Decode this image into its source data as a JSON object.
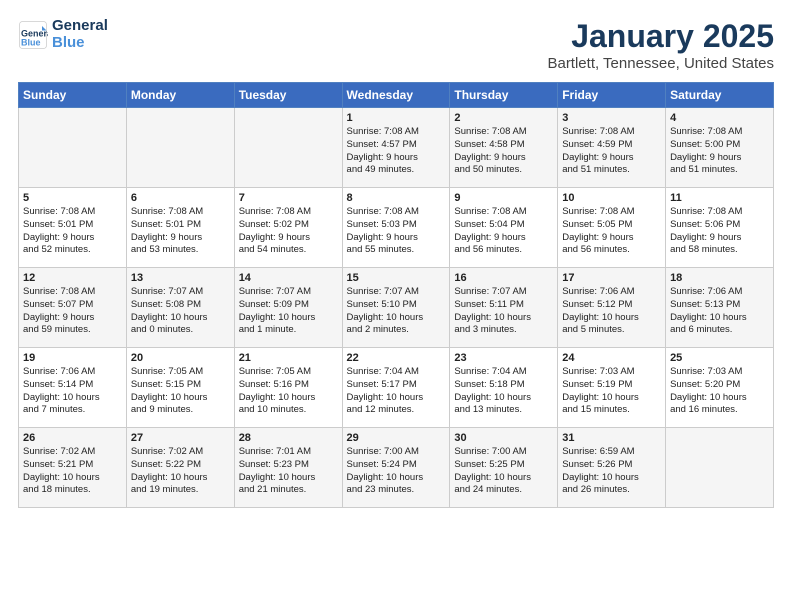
{
  "header": {
    "logo_line1": "General",
    "logo_line2": "Blue",
    "title": "January 2025",
    "subtitle": "Bartlett, Tennessee, United States"
  },
  "weekdays": [
    "Sunday",
    "Monday",
    "Tuesday",
    "Wednesday",
    "Thursday",
    "Friday",
    "Saturday"
  ],
  "weeks": [
    [
      {
        "day": "",
        "info": ""
      },
      {
        "day": "",
        "info": ""
      },
      {
        "day": "",
        "info": ""
      },
      {
        "day": "1",
        "info": "Sunrise: 7:08 AM\nSunset: 4:57 PM\nDaylight: 9 hours\nand 49 minutes."
      },
      {
        "day": "2",
        "info": "Sunrise: 7:08 AM\nSunset: 4:58 PM\nDaylight: 9 hours\nand 50 minutes."
      },
      {
        "day": "3",
        "info": "Sunrise: 7:08 AM\nSunset: 4:59 PM\nDaylight: 9 hours\nand 51 minutes."
      },
      {
        "day": "4",
        "info": "Sunrise: 7:08 AM\nSunset: 5:00 PM\nDaylight: 9 hours\nand 51 minutes."
      }
    ],
    [
      {
        "day": "5",
        "info": "Sunrise: 7:08 AM\nSunset: 5:01 PM\nDaylight: 9 hours\nand 52 minutes."
      },
      {
        "day": "6",
        "info": "Sunrise: 7:08 AM\nSunset: 5:01 PM\nDaylight: 9 hours\nand 53 minutes."
      },
      {
        "day": "7",
        "info": "Sunrise: 7:08 AM\nSunset: 5:02 PM\nDaylight: 9 hours\nand 54 minutes."
      },
      {
        "day": "8",
        "info": "Sunrise: 7:08 AM\nSunset: 5:03 PM\nDaylight: 9 hours\nand 55 minutes."
      },
      {
        "day": "9",
        "info": "Sunrise: 7:08 AM\nSunset: 5:04 PM\nDaylight: 9 hours\nand 56 minutes."
      },
      {
        "day": "10",
        "info": "Sunrise: 7:08 AM\nSunset: 5:05 PM\nDaylight: 9 hours\nand 56 minutes."
      },
      {
        "day": "11",
        "info": "Sunrise: 7:08 AM\nSunset: 5:06 PM\nDaylight: 9 hours\nand 58 minutes."
      }
    ],
    [
      {
        "day": "12",
        "info": "Sunrise: 7:08 AM\nSunset: 5:07 PM\nDaylight: 9 hours\nand 59 minutes."
      },
      {
        "day": "13",
        "info": "Sunrise: 7:07 AM\nSunset: 5:08 PM\nDaylight: 10 hours\nand 0 minutes."
      },
      {
        "day": "14",
        "info": "Sunrise: 7:07 AM\nSunset: 5:09 PM\nDaylight: 10 hours\nand 1 minute."
      },
      {
        "day": "15",
        "info": "Sunrise: 7:07 AM\nSunset: 5:10 PM\nDaylight: 10 hours\nand 2 minutes."
      },
      {
        "day": "16",
        "info": "Sunrise: 7:07 AM\nSunset: 5:11 PM\nDaylight: 10 hours\nand 3 minutes."
      },
      {
        "day": "17",
        "info": "Sunrise: 7:06 AM\nSunset: 5:12 PM\nDaylight: 10 hours\nand 5 minutes."
      },
      {
        "day": "18",
        "info": "Sunrise: 7:06 AM\nSunset: 5:13 PM\nDaylight: 10 hours\nand 6 minutes."
      }
    ],
    [
      {
        "day": "19",
        "info": "Sunrise: 7:06 AM\nSunset: 5:14 PM\nDaylight: 10 hours\nand 7 minutes."
      },
      {
        "day": "20",
        "info": "Sunrise: 7:05 AM\nSunset: 5:15 PM\nDaylight: 10 hours\nand 9 minutes."
      },
      {
        "day": "21",
        "info": "Sunrise: 7:05 AM\nSunset: 5:16 PM\nDaylight: 10 hours\nand 10 minutes."
      },
      {
        "day": "22",
        "info": "Sunrise: 7:04 AM\nSunset: 5:17 PM\nDaylight: 10 hours\nand 12 minutes."
      },
      {
        "day": "23",
        "info": "Sunrise: 7:04 AM\nSunset: 5:18 PM\nDaylight: 10 hours\nand 13 minutes."
      },
      {
        "day": "24",
        "info": "Sunrise: 7:03 AM\nSunset: 5:19 PM\nDaylight: 10 hours\nand 15 minutes."
      },
      {
        "day": "25",
        "info": "Sunrise: 7:03 AM\nSunset: 5:20 PM\nDaylight: 10 hours\nand 16 minutes."
      }
    ],
    [
      {
        "day": "26",
        "info": "Sunrise: 7:02 AM\nSunset: 5:21 PM\nDaylight: 10 hours\nand 18 minutes."
      },
      {
        "day": "27",
        "info": "Sunrise: 7:02 AM\nSunset: 5:22 PM\nDaylight: 10 hours\nand 19 minutes."
      },
      {
        "day": "28",
        "info": "Sunrise: 7:01 AM\nSunset: 5:23 PM\nDaylight: 10 hours\nand 21 minutes."
      },
      {
        "day": "29",
        "info": "Sunrise: 7:00 AM\nSunset: 5:24 PM\nDaylight: 10 hours\nand 23 minutes."
      },
      {
        "day": "30",
        "info": "Sunrise: 7:00 AM\nSunset: 5:25 PM\nDaylight: 10 hours\nand 24 minutes."
      },
      {
        "day": "31",
        "info": "Sunrise: 6:59 AM\nSunset: 5:26 PM\nDaylight: 10 hours\nand 26 minutes."
      },
      {
        "day": "",
        "info": ""
      }
    ]
  ]
}
